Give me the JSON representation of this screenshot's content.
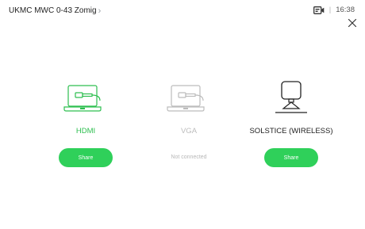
{
  "header": {
    "room_name": "UKMC MWC 0-43 Zomig",
    "time": "16:38",
    "separator": "|"
  },
  "sources": [
    {
      "label": "HDMI",
      "state": "Share",
      "icon": "laptop-hdmi-icon",
      "color": "#2dbf4f"
    },
    {
      "label": "VGA",
      "state": "Not connected",
      "icon": "laptop-vga-icon",
      "color": "#bcbcbc"
    },
    {
      "label": "SOLSTICE (WIRELESS)",
      "state": "Share",
      "icon": "wireless-display-icon",
      "color": "#222222"
    }
  ],
  "colors": {
    "accent": "#2fd05a",
    "disabled": "#bcbcbc"
  }
}
